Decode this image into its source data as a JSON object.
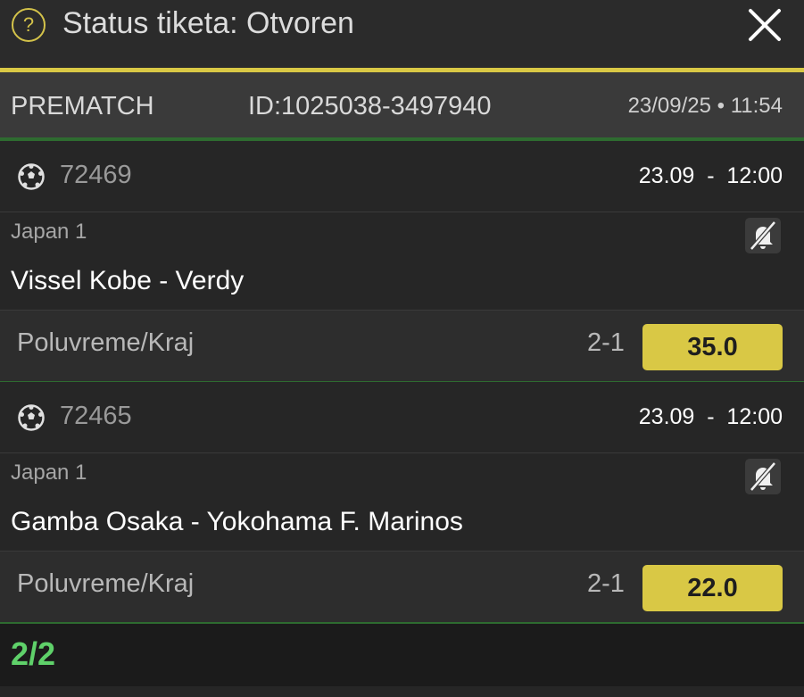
{
  "header": {
    "title": "Status tiketa: Otvoren",
    "help_icon": "question-circle-icon",
    "close_icon": "close-icon",
    "accent_color": "#d9c845"
  },
  "ticket": {
    "type": "PREMATCH",
    "id": "ID:1025038-3497940",
    "datetime": "23/09/25 • 11:54"
  },
  "events": [
    {
      "code": "72469",
      "time": "23.09  -  12:00",
      "league": "Japan 1",
      "match": "Vissel Kobe - Verdy",
      "market": "Poluvreme/Kraj",
      "pick": "2-1",
      "odds": "35.0"
    },
    {
      "code": "72465",
      "time": "23.09  -  12:00",
      "league": "Japan 1",
      "match": "Gamba Osaka - Yokohama F. Marinos",
      "market": "Poluvreme/Kraj",
      "pick": "2-1",
      "odds": "22.0"
    }
  ],
  "footer": {
    "count": "2/2",
    "count_color": "#5fd16a"
  }
}
